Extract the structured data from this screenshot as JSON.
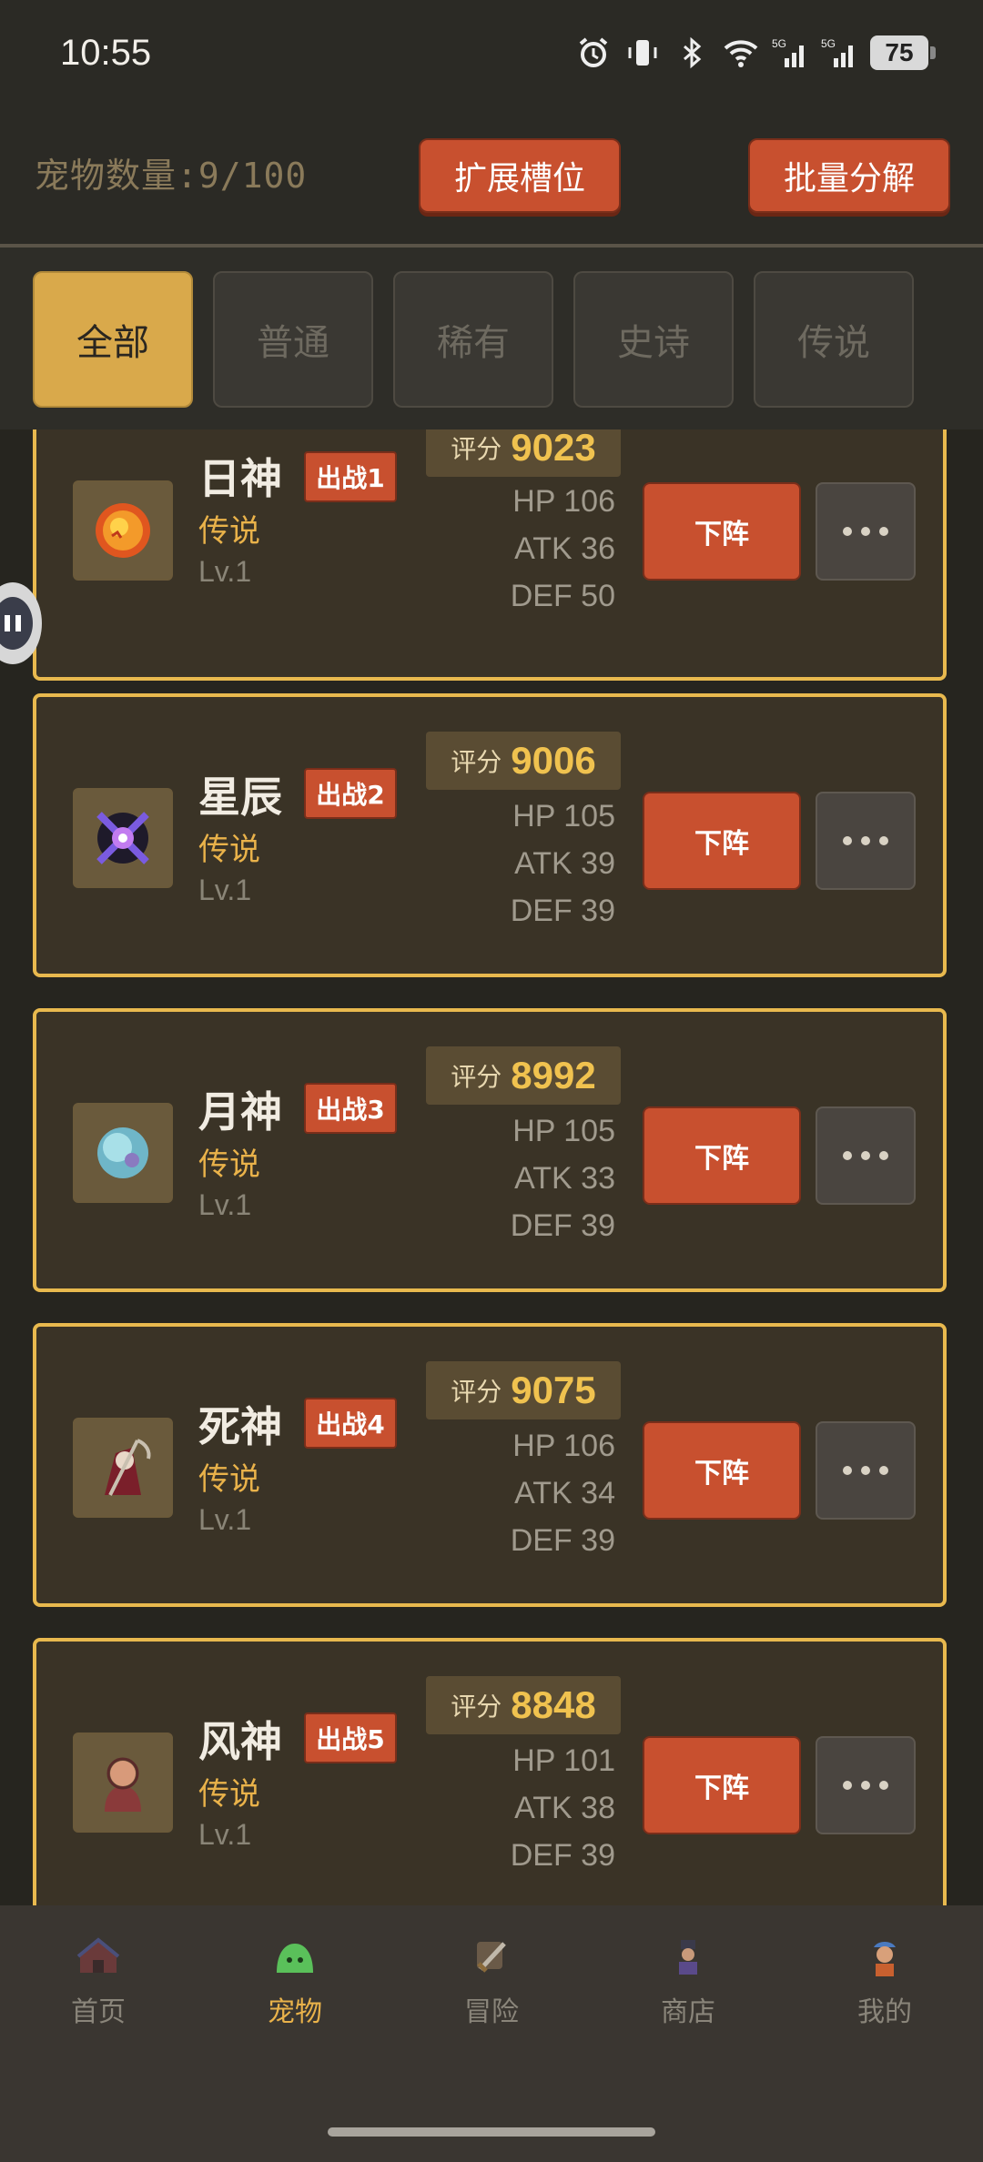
{
  "status_bar": {
    "time": "10:55",
    "battery": "75"
  },
  "header": {
    "pet_count": "宠物数量:9/100",
    "expand_label": "扩展槽位",
    "decompose_label": "批量分解"
  },
  "filters": [
    {
      "label": "全部",
      "active": true
    },
    {
      "label": "普通",
      "active": false
    },
    {
      "label": "稀有",
      "active": false
    },
    {
      "label": "史诗",
      "active": false
    },
    {
      "label": "传说",
      "active": false
    }
  ],
  "pets": [
    {
      "name": "日神",
      "badge": "出战1",
      "rarity": "传说",
      "level": "Lv.1",
      "score_label": "评分",
      "score": "9023",
      "hp": "HP 106",
      "atk": "ATK 36",
      "def": "DEF 50",
      "action": "下阵",
      "icon": "sun-orb-icon"
    },
    {
      "name": "星辰",
      "badge": "出战2",
      "rarity": "传说",
      "level": "Lv.1",
      "score_label": "评分",
      "score": "9006",
      "hp": "HP 105",
      "atk": "ATK 39",
      "def": "DEF 39",
      "action": "下阵",
      "icon": "star-rune-icon"
    },
    {
      "name": "月神",
      "badge": "出战3",
      "rarity": "传说",
      "level": "Lv.1",
      "score_label": "评分",
      "score": "8992",
      "hp": "HP 105",
      "atk": "ATK 33",
      "def": "DEF 39",
      "action": "下阵",
      "icon": "moon-orb-icon"
    },
    {
      "name": "死神",
      "badge": "出战4",
      "rarity": "传说",
      "level": "Lv.1",
      "score_label": "评分",
      "score": "9075",
      "hp": "HP 106",
      "atk": "ATK 34",
      "def": "DEF 39",
      "action": "下阵",
      "icon": "reaper-icon"
    },
    {
      "name": "风神",
      "badge": "出战5",
      "rarity": "传说",
      "level": "Lv.1",
      "score_label": "评分",
      "score": "8848",
      "hp": "HP 101",
      "atk": "ATK 38",
      "def": "DEF 39",
      "action": "下阵",
      "icon": "monk-icon"
    }
  ],
  "nav": [
    {
      "label": "首页",
      "icon": "house-icon",
      "active": false
    },
    {
      "label": "宠物",
      "icon": "slime-icon",
      "active": true
    },
    {
      "label": "冒险",
      "icon": "sword-icon",
      "active": false
    },
    {
      "label": "商店",
      "icon": "shopkeeper-icon",
      "active": false
    },
    {
      "label": "我的",
      "icon": "player-icon",
      "active": false
    }
  ],
  "colors": {
    "accent": "#c8502f",
    "gold": "#e8b94e",
    "background": "#2b2a25"
  }
}
